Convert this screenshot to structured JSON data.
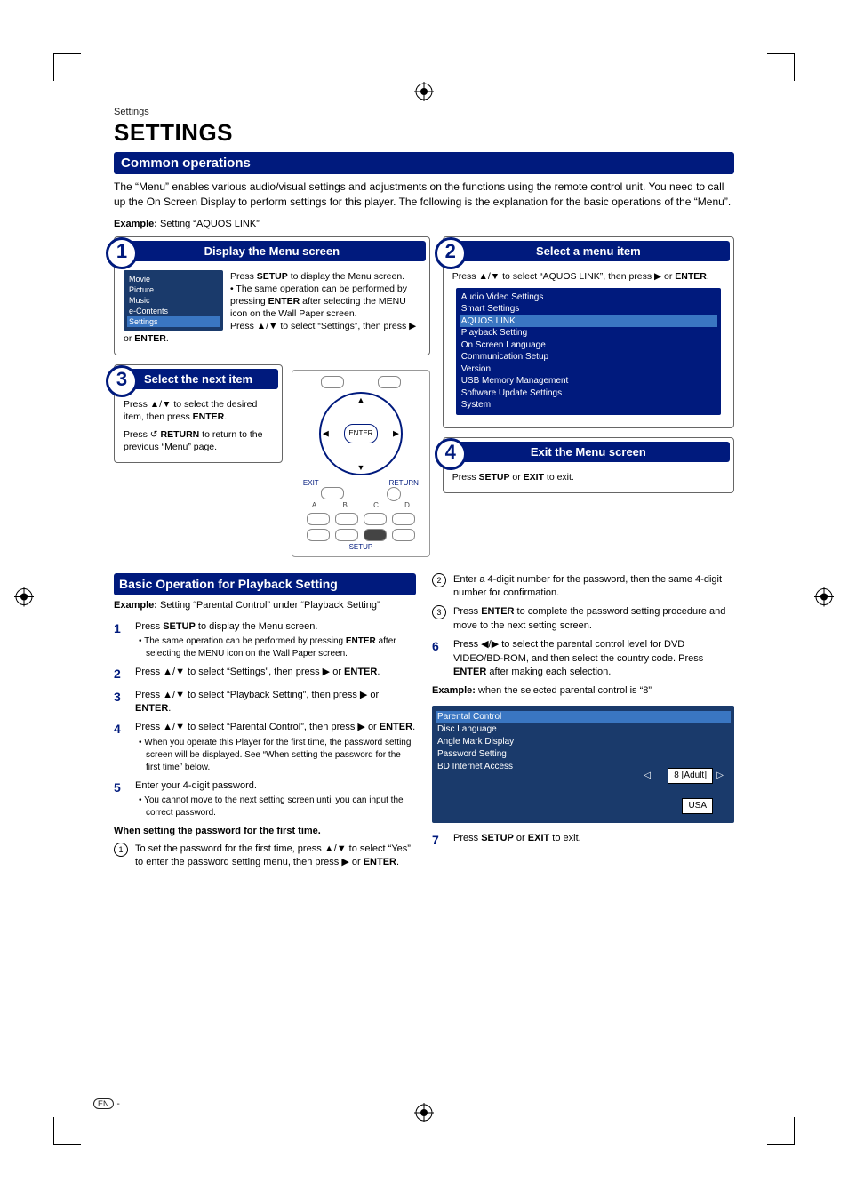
{
  "breadcrumb": "Settings",
  "pageTitle": "SETTINGS",
  "sectionBar1": "Common operations",
  "introText": "The “Menu” enables various audio/visual settings and adjustments on the functions using the remote control unit. You need to call up the On Screen Display to perform settings for this player. The following is the explanation for the basic operations of the “Menu”.",
  "exampleLabel": "Example:",
  "exampleText": " Setting “AQUOS LINK”",
  "step1": {
    "num": "1",
    "title": "Display the Menu screen",
    "menuItems": [
      "Movie",
      "Picture",
      "Music",
      "e-Contents",
      "Settings"
    ],
    "bodyLines": [
      "Press <b>SETUP</b> to display the Menu screen.",
      "• The same operation can be performed by pressing <b>ENTER</b> after selecting the MENU icon on the Wall Paper screen.",
      "Press ▲/▼ to select “Settings”, then press ▶ or <b>ENTER</b>."
    ]
  },
  "step2": {
    "num": "2",
    "title": "Select a menu item",
    "text": "Press ▲/▼ to select “AQUOS LINK”, then press ▶ or <b>ENTER</b>.",
    "menuItems": [
      "Audio Video Settings",
      "Smart Settings",
      "AQUOS LINK",
      "Playback Setting",
      "On Screen Language",
      "Communication Setup",
      "Version",
      "USB Memory Management",
      "Software Update Settings",
      "System"
    ]
  },
  "step3": {
    "num": "3",
    "title": "Select the next item",
    "line1": "Press ▲/▼ to select the desired item, then press <b>ENTER</b>.",
    "line2": "Press ↺ <b>RETURN</b> to return to the previous “Menu” page."
  },
  "remote": {
    "enter": "ENTER",
    "exit": "EXIT",
    "return": "RETURN",
    "abcd": [
      "A",
      "B",
      "C",
      "D"
    ],
    "setup": "SETUP"
  },
  "step4": {
    "num": "4",
    "title": "Exit the Menu screen",
    "text": "Press <b>SETUP</b> or <b>EXIT</b> to exit."
  },
  "sectionBar2": "Basic Operation for Playback Setting",
  "example2Label": "Example:",
  "example2Text": " Setting “Parental Control” under “Playback Setting”",
  "leftSteps": [
    {
      "n": "1",
      "main": "Press <b>SETUP</b> to display the Menu screen.",
      "sub": "• The same operation can be performed by pressing <b>ENTER</b> after selecting the MENU icon on the Wall Paper screen."
    },
    {
      "n": "2",
      "main": "Press ▲/▼ to select “Settings”, then press ▶ or <b>ENTER</b>."
    },
    {
      "n": "3",
      "main": "Press ▲/▼ to select “Playback Setting”, then press ▶ or <b>ENTER</b>."
    },
    {
      "n": "4",
      "main": "Press ▲/▼ to select “Parental Control”, then press ▶ or <b>ENTER</b>.",
      "sub": "• When you operate this Player for the first time, the password setting screen will be displayed. See “When setting the password for the first time” below."
    },
    {
      "n": "5",
      "main": "Enter your 4-digit password.",
      "sub": "• You cannot move to the next setting screen until you can input the correct password."
    }
  ],
  "firstTimeHeader": "When setting the password for the first time.",
  "firstTimeBullet1": "To set the password for the first time, press ▲/▼ to select “Yes” to enter the password setting menu, then press ▶ or <b>ENTER</b>.",
  "rightSteps": [
    {
      "c": "②",
      "main": "Enter a 4-digit number for the password, then the same 4-digit number for confirmation."
    },
    {
      "c": "③",
      "main": "Press <b>ENTER</b> to complete the password setting procedure and move to the next setting screen."
    }
  ],
  "step6": {
    "n": "6",
    "main": "Press ◀/▶ to select the parental control level for DVD VIDEO/BD-ROM, and then select the country code. Press <b>ENTER</b> after making each selection."
  },
  "example3Label": "Example:",
  "example3Text": " when the selected parental control is “8”",
  "pbMenu": [
    "Parental Control",
    "Disc Language",
    "Angle Mark Display",
    "Password Setting",
    "BD Internet Access"
  ],
  "pbValue": "8 [Adult]",
  "pbCountry": "USA",
  "step7": {
    "n": "7",
    "main": "Press <b>SETUP</b> or <b>EXIT</b> to exit."
  },
  "footer": {
    "badge": "EN",
    "dash": "-"
  }
}
